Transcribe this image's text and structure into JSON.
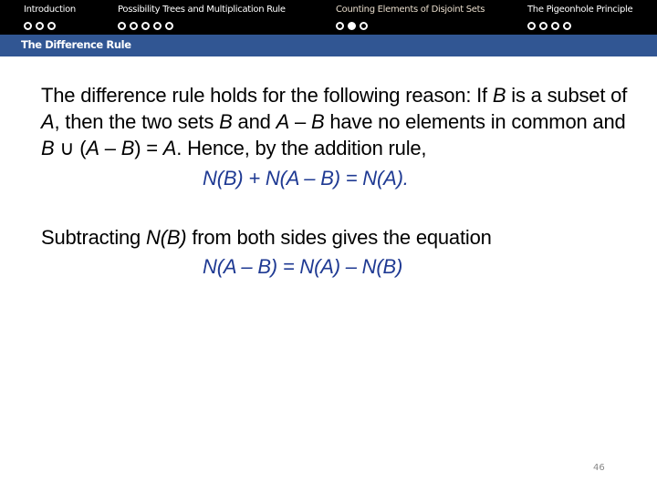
{
  "navigation": {
    "sections": [
      {
        "label": "Introduction",
        "dots": 3,
        "current_dot": null,
        "active": false
      },
      {
        "label": "Possibility Trees and Multiplication Rule",
        "dots": 5,
        "current_dot": null,
        "active": false
      },
      {
        "label": "Counting Elements of Disjoint Sets",
        "dots": 3,
        "current_dot": 2,
        "active": true
      },
      {
        "label": "The Pigeonhole Principle",
        "dots": 4,
        "current_dot": null,
        "active": false
      }
    ]
  },
  "frame": {
    "title": "The Difference Rule"
  },
  "body": {
    "paragraph1": {
      "t1": "The difference rule holds for the following reason: If ",
      "v1": "B",
      "t2": " is a subset of ",
      "v2": "A",
      "t3": ", then the two sets ",
      "v3": "B",
      "t4": " and ",
      "v4": "A",
      "t5": " – ",
      "v5": "B",
      "t6": " have no elements in common and ",
      "v6": "B",
      "t7": " ∪ (",
      "v7": "A",
      "t8": " – ",
      "v8": "B",
      "t9": ") = ",
      "v9": "A",
      "t10": ". Hence, by the addition rule,"
    },
    "equation1": "N(B) + N(A – B) = N(A).",
    "paragraph2": {
      "t1": "Subtracting ",
      "v1": "N(B)",
      "t2": " from both sides gives the equation"
    },
    "equation2": "N(A – B) = N(A) – N(B)"
  },
  "footer": {
    "page_number": "46"
  },
  "colors": {
    "nav_background": "#000000",
    "title_bar": "#315693",
    "active_section": "#e8dccb",
    "equation": "#1f3a93"
  }
}
